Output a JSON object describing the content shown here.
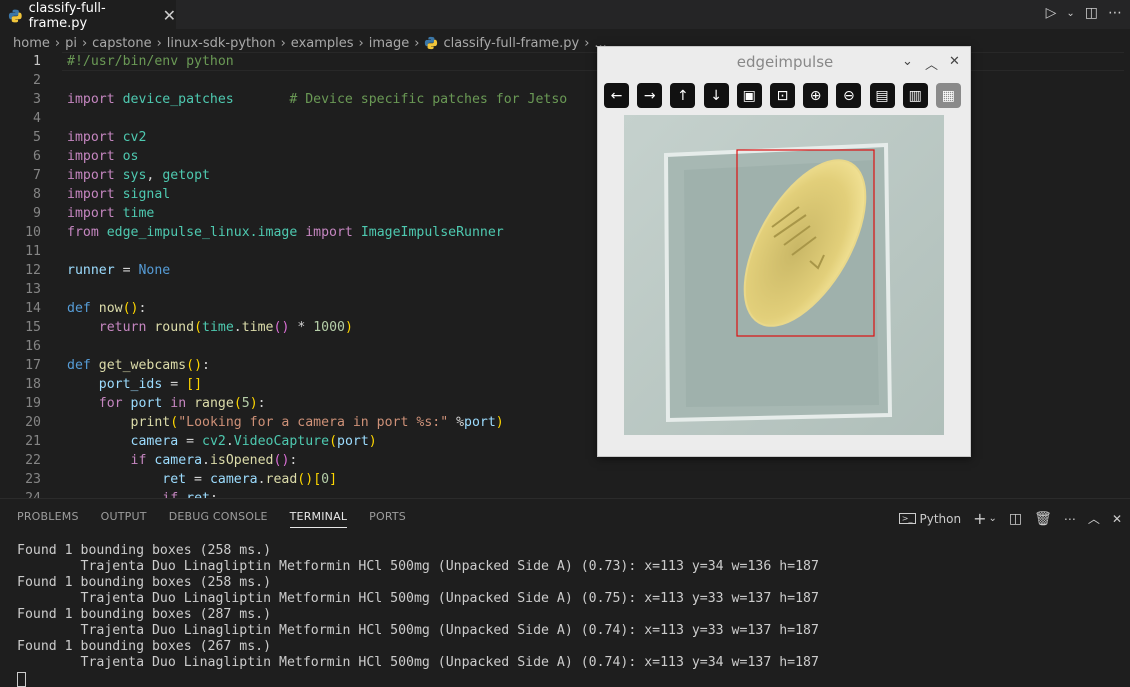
{
  "tab": {
    "filename": "classify-full-frame.py"
  },
  "breadcrumb": [
    "home",
    "pi",
    "capstone",
    "linux-sdk-python",
    "examples",
    "image",
    "classify-full-frame.py",
    "..."
  ],
  "editor": {
    "line_numbers": [
      "1",
      "2",
      "3",
      "4",
      "5",
      "6",
      "7",
      "8",
      "9",
      "10",
      "11",
      "12",
      "13",
      "14",
      "15",
      "16",
      "17",
      "18",
      "19",
      "20",
      "21",
      "22",
      "23",
      "24"
    ]
  },
  "panel": {
    "tabs": [
      "PROBLEMS",
      "OUTPUT",
      "DEBUG CONSOLE",
      "TERMINAL",
      "PORTS"
    ],
    "active_tab": "TERMINAL",
    "shell_label": "Python",
    "terminal_lines": [
      "Found 1 bounding boxes (258 ms.)",
      "        Trajenta Duo Linagliptin Metformin HCl 500mg (Unpacked Side A) (0.73): x=113 y=34 w=136 h=187",
      "Found 1 bounding boxes (258 ms.)",
      "        Trajenta Duo Linagliptin Metformin HCl 500mg (Unpacked Side A) (0.75): x=113 y=33 w=137 h=187",
      "Found 1 bounding boxes (287 ms.)",
      "        Trajenta Duo Linagliptin Metformin HCl 500mg (Unpacked Side A) (0.74): x=113 y=33 w=137 h=187",
      "Found 1 bounding boxes (267 ms.)",
      "        Trajenta Duo Linagliptin Metformin HCl 500mg (Unpacked Side A) (0.74): x=113 y=34 w=137 h=187"
    ]
  },
  "image_window": {
    "title": "edgeimpulse",
    "tools": [
      "arrow-left-icon",
      "arrow-right-icon",
      "arrow-up-icon",
      "arrow-down-icon",
      "image-icon",
      "image-search-icon",
      "zoom-in-icon",
      "zoom-out-icon",
      "save-icon",
      "clipboard-icon",
      "paint-brush-icon"
    ]
  },
  "code": {
    "l1": "#!/usr/bin/env python",
    "l3a": "import",
    "l3b": "device_patches",
    "l3c": "# Device specific patches for Jetso",
    "imp": "import",
    "cv2": "cv2",
    "os": "os",
    "sys": "sys",
    "getopt": "getopt",
    "signal": "signal",
    "time": "time",
    "from": "from",
    "eil": "edge_impulse_linux.image",
    "iir": "ImageImpulseRunner",
    "runner": "runner",
    "none": "None",
    "def": "def",
    "now": "now",
    "ret_kw": "return",
    "round": "round",
    "timefn": "time",
    "n1000": "1000",
    "getwc": "get_webcams",
    "port_ids": "port_ids",
    "for": "for",
    "port": "port",
    "in": "in",
    "range": "range",
    "n5": "5",
    "print": "print",
    "pstr": "\"Looking for a camera in port %s:\"",
    "camera": "camera",
    "vc": "VideoCapture",
    "if": "if",
    "isOpened": "isOpened",
    "ret": "ret",
    "read": "read",
    "n0": "0"
  }
}
